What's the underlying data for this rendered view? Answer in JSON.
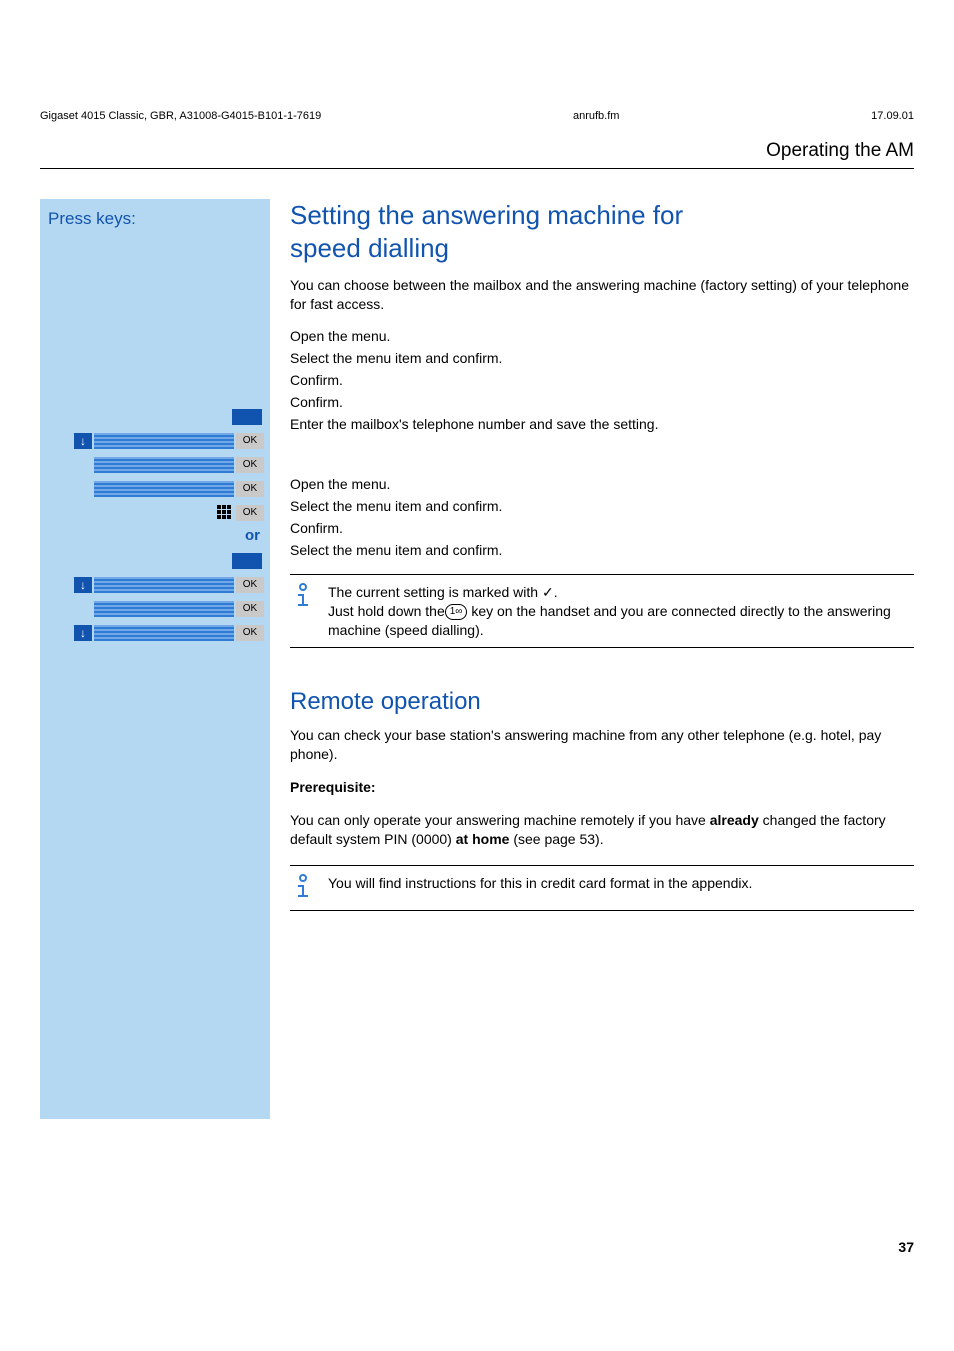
{
  "meta_left": "Gigaset 4015 Classic, GBR, A31008-G4015-B101-1-7619",
  "meta_center": "anrufb.fm",
  "meta_right": "17.09.01",
  "header_title": "Operating the AM",
  "sidebar": {
    "press_keys": "Press keys:",
    "ok": "OK",
    "or": "or",
    "arrow_down": "↓"
  },
  "section1": {
    "heading_line1": "Setting the answering machine for",
    "heading_line2": "speed dialling",
    "para1": "You can choose between the mailbox and the answering machine (factory setting) of your telephone for fast access.",
    "steps_a": [
      "Open the menu.",
      "Select the menu item and confirm.",
      "Confirm.",
      "Confirm.",
      "Enter the mailbox's telephone number and save the setting."
    ],
    "steps_b": [
      "Open the menu.",
      "Select the menu item and confirm.",
      "Confirm.",
      "Select the menu item and confirm."
    ],
    "note_pre": "The current setting is marked with ",
    "note_check": "✓",
    "note_post1": ".",
    "note_line2a": "Just hold down the",
    "note_keycap": "1∞",
    "note_line2b": " key on the handset and you are connected directly to the answering machine (speed dialling)."
  },
  "section2": {
    "heading": "Remote operation",
    "para1": "You can check your base station's answering machine from any other telephone (e.g. hotel, pay phone).",
    "prereq_label": "Prerequisite:",
    "para2a": "You can only operate your answering machine remotely if you have ",
    "bold1": "already",
    "para2b": " changed the factory default system PIN (0000) ",
    "bold2": "at home",
    "para2c": " (see page 53).",
    "note": "You will find instructions for this in credit card format in the appendix."
  },
  "pagenum": "37"
}
